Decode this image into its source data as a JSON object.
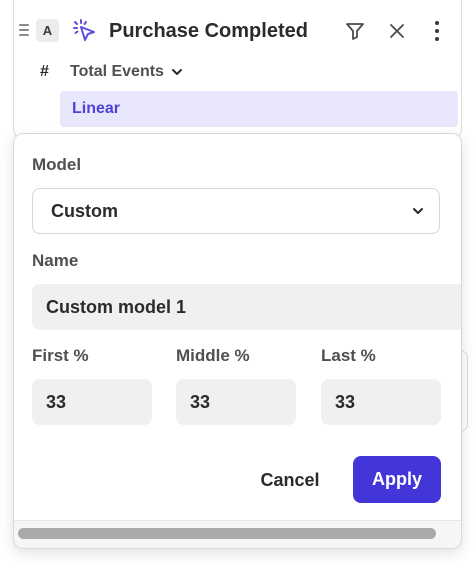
{
  "event": {
    "badge": "A",
    "title": "Purchase Completed",
    "metric_symbol": "#",
    "metric_label": "Total Events",
    "attribution_chip": "Linear"
  },
  "popover": {
    "model_label": "Model",
    "model_value": "Custom",
    "name_label": "Name",
    "name_value": "Custom model 1",
    "first_label": "First %",
    "middle_label": "Middle %",
    "last_label": "Last %",
    "first_value": "33",
    "middle_value": "33",
    "last_value": "33",
    "cancel_label": "Cancel",
    "apply_label": "Apply"
  },
  "colors": {
    "accent": "#4336d8",
    "chip_bg": "#e9e7fb",
    "chip_text": "#4f43d6",
    "field_bg": "#f0f0f0"
  },
  "icons": [
    "drag-handle-icon",
    "click-cursor-icon",
    "filter-icon",
    "close-icon",
    "more-vertical-icon",
    "chevron-down-icon"
  ]
}
